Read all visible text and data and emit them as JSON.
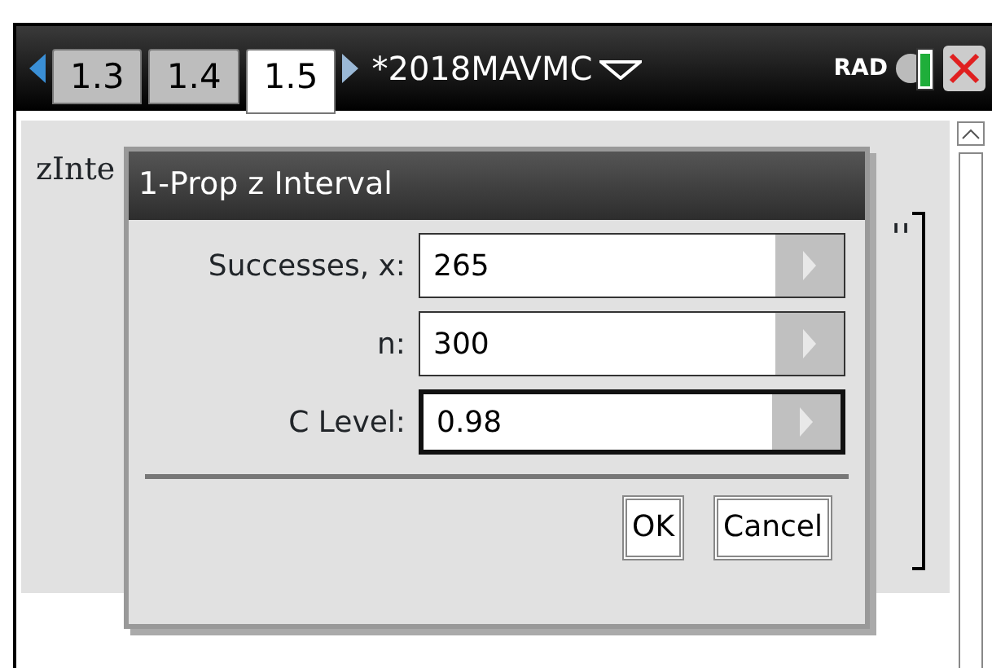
{
  "header": {
    "tabs": [
      {
        "label": "1.3",
        "selected": false
      },
      {
        "label": "1.4",
        "selected": false
      },
      {
        "label": "1.5",
        "selected": true
      }
    ],
    "document_title": "*2018MAVMC",
    "angle_mode": "RAD"
  },
  "background": {
    "entry_text": "zInte",
    "fragment": "''"
  },
  "dialog": {
    "title": "1-Prop z Interval",
    "fields": [
      {
        "label": "Successes, x:",
        "value": "265",
        "focused": false
      },
      {
        "label": "n:",
        "value": "300",
        "focused": false
      },
      {
        "label": "C Level:",
        "value": "0.98",
        "focused": true
      }
    ],
    "buttons": [
      "OK",
      "Cancel"
    ]
  }
}
